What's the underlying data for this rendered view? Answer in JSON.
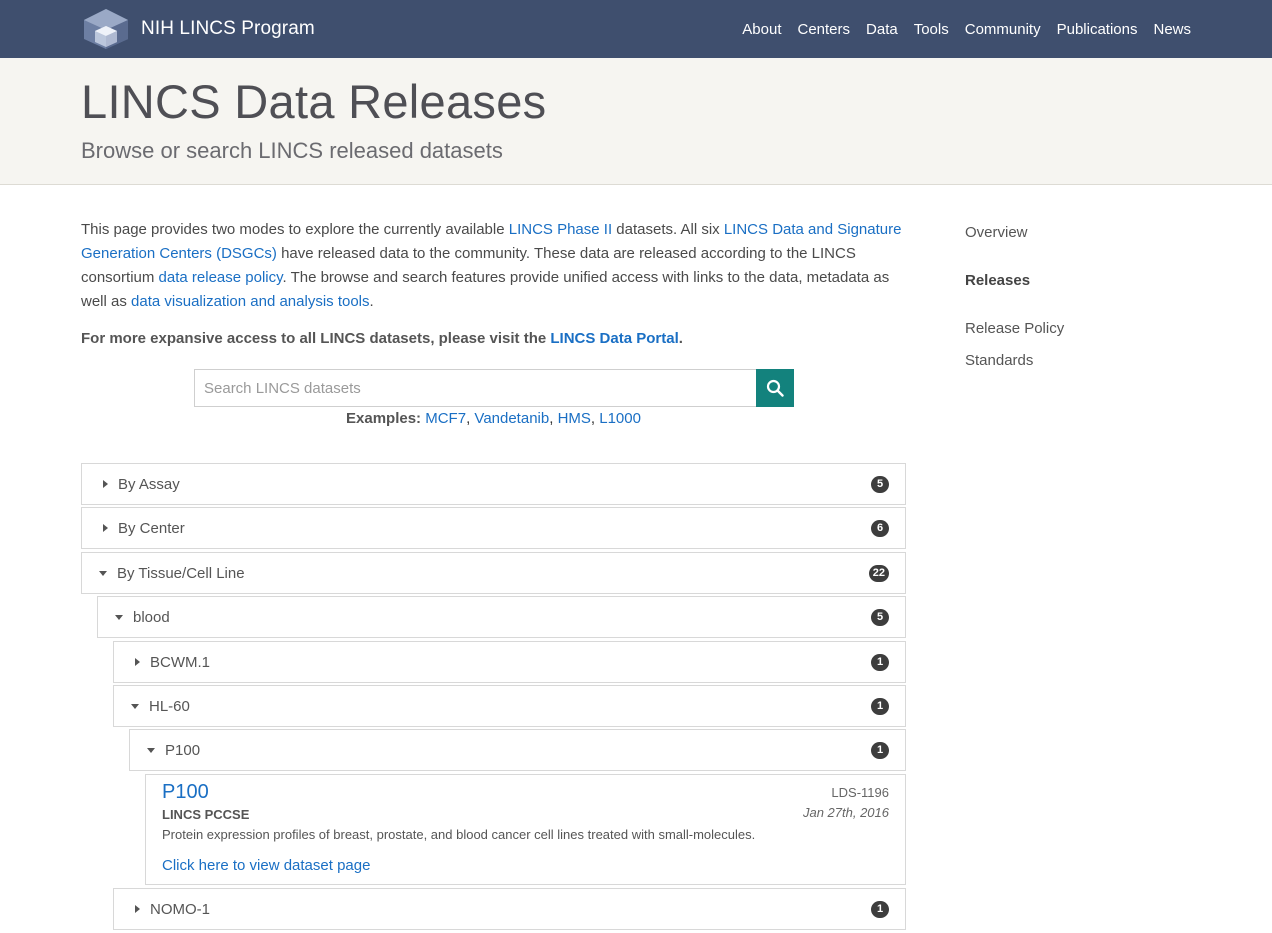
{
  "nav": {
    "brand": "NIH LINCS Program",
    "items": [
      "About",
      "Centers",
      "Data",
      "Tools",
      "Community",
      "Publications",
      "News"
    ]
  },
  "header": {
    "title": "LINCS Data Releases",
    "subtitle": "Browse or search LINCS released datasets"
  },
  "intro": {
    "t1": "This page provides two modes to explore the currently available ",
    "l1": "LINCS Phase II",
    "t2": " datasets. All six ",
    "l2": "LINCS Data and Signature Generation Centers (DSGCs)",
    "t3": " have released data to the community. These data are released according to the LINCS consortium ",
    "l3": "data release policy",
    "t4": ". The browse and search features provide unified access with links to the data, metadata as well as ",
    "l4": "data visualization and analysis tools",
    "t5": "."
  },
  "portal": {
    "text": "For more expansive access to all LINCS datasets, please visit the ",
    "link": "LINCS Data Portal",
    "end": "."
  },
  "search": {
    "placeholder": "Search LINCS datasets",
    "examples_label": "Examples:",
    "examples": [
      "MCF7",
      "Vandetanib",
      "HMS",
      "L1000"
    ]
  },
  "tree": {
    "by_assay": {
      "label": "By Assay",
      "count": "5"
    },
    "by_center": {
      "label": "By Center",
      "count": "6"
    },
    "by_tissue": {
      "label": "By Tissue/Cell Line",
      "count": "22"
    },
    "blood": {
      "label": "blood",
      "count": "5"
    },
    "bcwm": {
      "label": "BCWM.1",
      "count": "1"
    },
    "hl60": {
      "label": "HL-60",
      "count": "1"
    },
    "p100": {
      "label": "P100",
      "count": "1"
    },
    "nomo": {
      "label": "NOMO-1",
      "count": "1"
    }
  },
  "dataset": {
    "title": "P100",
    "center": "LINCS PCCSE",
    "description": "Protein expression profiles of breast, prostate, and blood cancer cell lines treated with small-molecules.",
    "link": "Click here to view dataset page",
    "id": "LDS-1196",
    "date": "Jan 27th, 2016"
  },
  "sidebar": {
    "items": [
      "Overview",
      "Releases",
      "Release Policy",
      "Standards"
    ]
  },
  "colors": {
    "navbar": "#3f4f6e",
    "accent": "#13827d",
    "link": "#1a6fc4"
  }
}
